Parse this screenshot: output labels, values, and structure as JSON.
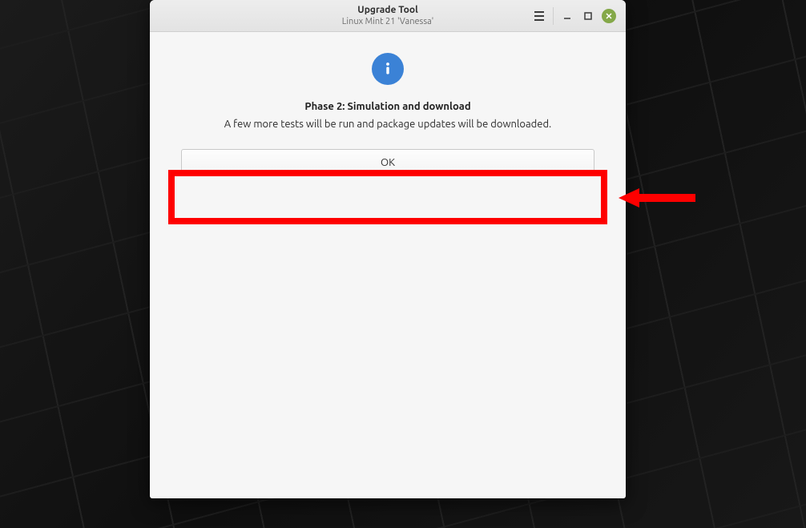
{
  "window": {
    "title": "Upgrade Tool",
    "subtitle": "Linux Mint 21 'Vanessa'"
  },
  "content": {
    "heading": "Phase 2: Simulation and download",
    "description": "A few more tests will be run and package updates will be downloaded.",
    "ok_label": "OK"
  },
  "colors": {
    "highlight": "#fe0000",
    "close_button": "#84a848",
    "info_icon": "#3b82d6"
  }
}
